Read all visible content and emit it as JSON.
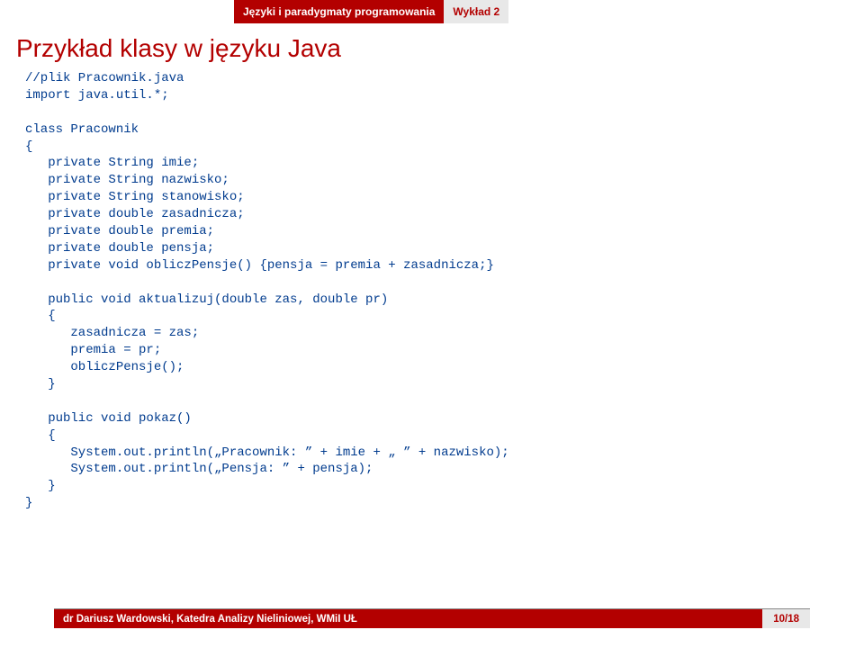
{
  "header": {
    "course": "Języki i paradygmaty programowania",
    "lecture": "Wykład 2"
  },
  "title": "Przykład klasy w języku Java",
  "code": {
    "l1": "//plik Pracownik.java",
    "l2": "import java.util.*;",
    "l3": "",
    "l4": "class Pracownik",
    "l5": "{",
    "l6": "   private String imie;",
    "l7": "   private String nazwisko;",
    "l8": "   private String stanowisko;",
    "l9": "   private double zasadnicza;",
    "l10": "   private double premia;",
    "l11": "   private double pensja;",
    "l12": "   private void obliczPensje() {pensja = premia + zasadnicza;}",
    "l13": "",
    "l14": "   public void aktualizuj(double zas, double pr)",
    "l15": "   {",
    "l16": "      zasadnicza = zas;",
    "l17": "      premia = pr;",
    "l18": "      obliczPensje();",
    "l19": "   }",
    "l20": "",
    "l21": "   public void pokaz()",
    "l22": "   {",
    "l23": "      System.out.println(„Pracownik: ” + imie + „ ” + nazwisko);",
    "l24": "      System.out.println(„Pensja: ” + pensja);",
    "l25": "   }",
    "l26": "}"
  },
  "footer": {
    "author": "dr Dariusz Wardowski, Katedra Analizy Nieliniowej, WMiI UŁ",
    "page": "10/18"
  }
}
